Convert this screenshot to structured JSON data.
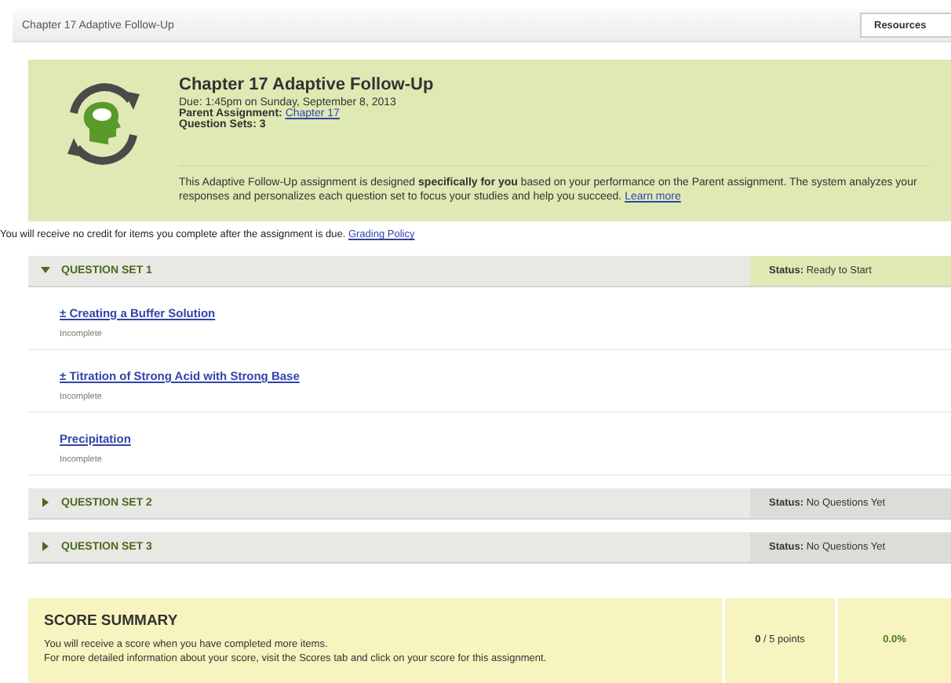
{
  "header": {
    "title": "Chapter 17 Adaptive Follow-Up",
    "button": "Resources"
  },
  "banner": {
    "title": "Chapter 17 Adaptive Follow-Up",
    "due": "Due: 1:45pm on Sunday, September 8, 2013",
    "parent_label": "Parent Assignment:",
    "parent_link": "Chapter 17",
    "sets_label": "Question Sets:",
    "sets_value": "3",
    "description": "This Adaptive Follow-Up assignment is designed **specifically for you** based on your performance on the Parent assignment. The system analyzes your responses and personalizes each question set to focus your studies and help you succeed.",
    "learn_more": "Learn more"
  },
  "notice": {
    "text": "You will receive no credit for items you complete after the assignment is due.",
    "link": "Grading Policy"
  },
  "question_sets": [
    {
      "title": "QUESTION SET 1",
      "expanded": true,
      "status": "**Status:** Ready to Start",
      "items": [
        {
          "title": "± Creating a Buffer Solution",
          "state": "Incomplete"
        },
        {
          "title": "± Titration of Strong Acid with Strong Base",
          "state": "Incomplete"
        },
        {
          "title": "Precipitation",
          "state": "Incomplete"
        }
      ]
    },
    {
      "title": "QUESTION SET 2",
      "expanded": false,
      "status": "**Status:** No Questions Yet"
    },
    {
      "title": "QUESTION SET 3",
      "expanded": false,
      "status": "**Status:** No Questions Yet"
    }
  ],
  "score_summary": {
    "title": "SCORE SUMMARY",
    "lines": [
      "You will receive a score when you have completed more items.",
      "For more detailed information about your score, visit the Scores tab and click on your score for this assignment."
    ],
    "points": "**0** / 5 points",
    "percent": "0.0%"
  }
}
